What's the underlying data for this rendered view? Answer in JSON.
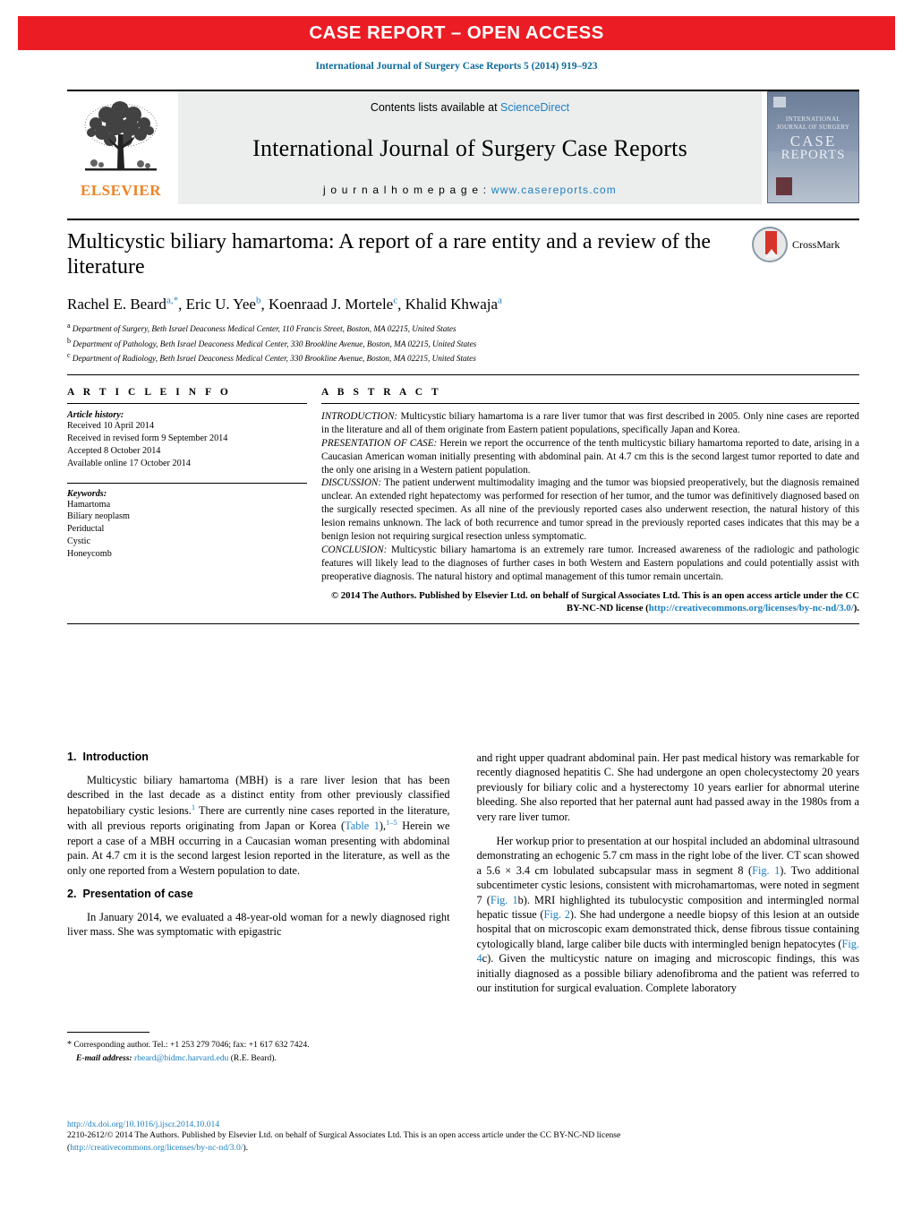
{
  "banner": {
    "text": "CASE REPORT – OPEN ACCESS",
    "color": "#ec1c24"
  },
  "journal_ref": "International Journal of Surgery Case Reports 5 (2014) 919–923",
  "masthead": {
    "publisher_name": "ELSEVIER",
    "publisher_logo_icon": "elsevier-tree-icon",
    "contents_prefix": "Contents lists available at ",
    "contents_link": "ScienceDirect",
    "journal_title": "International Journal of Surgery Case Reports",
    "homepage_prefix": "j o u r n a l   h o m e p a g e :  ",
    "homepage_url": "www.casereports.com",
    "cover": {
      "line1": "INTERNATIONAL",
      "line2": "JOURNAL OF SURGERY",
      "line3": "CASE",
      "line4": "REPORTS"
    }
  },
  "article": {
    "title": "Multicystic biliary hamartoma: A report of a rare entity and a review of the literature",
    "crossmark_label": "CrossMark",
    "authors": [
      {
        "name": "Rachel E. Beard",
        "marks": "a,*"
      },
      {
        "name": "Eric U. Yee",
        "marks": "b"
      },
      {
        "name": "Koenraad J. Mortele",
        "marks": "c"
      },
      {
        "name": "Khalid Khwaja",
        "marks": "a"
      }
    ],
    "affiliations": [
      {
        "mark": "a",
        "text": "Department of Surgery, Beth Israel Deaconess Medical Center, 110 Francis Street, Boston, MA 02215, United States"
      },
      {
        "mark": "b",
        "text": "Department of Pathology, Beth Israel Deaconess Medical Center, 330 Brookline Avenue, Boston, MA 02215, United States"
      },
      {
        "mark": "c",
        "text": "Department of Radiology, Beth Israel Deaconess Medical Center, 330 Brookline Avenue, Boston, MA 02215, United States"
      }
    ]
  },
  "article_info": {
    "heading": "A R T I C L E   I N F O",
    "history_label": "Article history:",
    "history": [
      "Received 10 April 2014",
      "Received in revised form 9 September 2014",
      "Accepted 8 October 2014",
      "Available online 17 October 2014"
    ],
    "keywords_label": "Keywords:",
    "keywords": [
      "Hamartoma",
      "Biliary neoplasm",
      "Periductal",
      "Cystic",
      "Honeycomb"
    ]
  },
  "abstract": {
    "heading": "A B S T R A C T",
    "sections": [
      {
        "label": "INTRODUCTION:",
        "text": " Multicystic biliary hamartoma is a rare liver tumor that was first described in 2005. Only nine cases are reported in the literature and all of them originate from Eastern patient populations, specifically Japan and Korea."
      },
      {
        "label": "PRESENTATION OF CASE:",
        "text": " Herein we report the occurrence of the tenth multicystic biliary hamartoma reported to date, arising in a Caucasian American woman initially presenting with abdominal pain. At 4.7 cm this is the second largest tumor reported to date and the only one arising in a Western patient population."
      },
      {
        "label": "DISCUSSION:",
        "text": " The patient underwent multimodality imaging and the tumor was biopsied preoperatively, but the diagnosis remained unclear. An extended right hepatectomy was performed for resection of her tumor, and the tumor was definitively diagnosed based on the surgically resected specimen. As all nine of the previously reported cases also underwent resection, the natural history of this lesion remains unknown. The lack of both recurrence and tumor spread in the previously reported cases indicates that this may be a benign lesion not requiring surgical resection unless symptomatic."
      },
      {
        "label": "CONCLUSION:",
        "text": " Multicystic biliary hamartoma is an extremely rare tumor. Increased awareness of the radiologic and pathologic features will likely lead to the diagnoses of further cases in both Western and Eastern populations and could potentially assist with preoperative diagnosis. The natural history and optimal management of this tumor remain uncertain."
      }
    ],
    "copyright_text": "© 2014 The Authors. Published by Elsevier Ltd. on behalf of Surgical Associates Ltd. This is an open access article under the CC BY-NC-ND license (",
    "copyright_link": "http://creativecommons.org/licenses/by-nc-nd/3.0/",
    "copyright_tail": ")."
  },
  "body": {
    "left": {
      "section1_num": "1.",
      "section1_title": "Introduction",
      "para1_a": "Multicystic biliary hamartoma (MBH) is a rare liver lesion that has been described in the last decade as a distinct entity from other previously classified hepatobiliary cystic lesions.",
      "ref1": "1",
      "para1_b": " There are currently nine cases reported in the literature, with all previous reports originating from Japan or Korea (",
      "table_link": "Table 1",
      "para1_c": "),",
      "ref2": "1–5",
      "para1_d": " Herein we report a case of a MBH occurring in a Caucasian woman presenting with abdominal pain. At 4.7 cm it is the second largest lesion reported in the literature, as well as the only one reported from a Western population to date.",
      "section2_num": "2.",
      "section2_title": "Presentation of case",
      "para2": "In January 2014, we evaluated a 48-year-old woman for a newly diagnosed right liver mass. She was symptomatic with epigastric"
    },
    "right": {
      "para_a": "and right upper quadrant abdominal pain. Her past medical history was remarkable for recently diagnosed hepatitis C. She had undergone an open cholecystectomy 20 years previously for biliary colic and a hysterectomy 10 years earlier for abnormal uterine bleeding. She also reported that her paternal aunt had passed away in the 1980s from a very rare liver tumor.",
      "para_b1": "Her workup prior to presentation at our hospital included an abdominal ultrasound demonstrating an echogenic 5.7 cm mass in the right lobe of the liver. CT scan showed a 5.6 × 3.4 cm lobulated subcapsular mass in segment 8 (",
      "fig1": "Fig. 1",
      "para_b2": "). Two additional subcentimeter cystic lesions, consistent with microhamartomas, were noted in segment 7 (",
      "fig1b": "Fig. 1",
      "para_b3": "b). MRI highlighted its tubulocystic composition and intermingled normal hepatic tissue (",
      "fig2": "Fig. 2",
      "para_b4": "). She had undergone a needle biopsy of this lesion at an outside hospital that on microscopic exam demonstrated thick, dense fibrous tissue containing cytologically bland, large caliber bile ducts with intermingled benign hepatocytes (",
      "fig4c": "Fig. 4",
      "para_b5": "c). Given the multicystic nature on imaging and microscopic findings, this was initially diagnosed as a possible biliary adenofibroma and the patient was referred to our institution for surgical evaluation. Complete laboratory"
    }
  },
  "footnote": {
    "star": "*",
    "corr_text": " Corresponding author. Tel.: +1 253 279 7046; fax: +1 617 632 7424.",
    "email_label": "E-mail address:",
    "email": "rbeard@bidmc.harvard.edu",
    "email_author": " (R.E. Beard)."
  },
  "bottom": {
    "doi": "http://dx.doi.org/10.1016/j.ijscr.2014.10.014",
    "line2": "2210-2612/© 2014 The Authors. Published by Elsevier Ltd. on behalf of Surgical Associates Ltd. This is an open access article under the CC BY-NC-ND license",
    "line3_open": "(",
    "line3_link": "http://creativecommons.org/licenses/by-nc-nd/3.0/",
    "line3_close": ")."
  },
  "colors": {
    "banner_red": "#ec1c24",
    "link_blue": "#1a7fc1",
    "elsevier_orange": "#f08222",
    "masthead_grey": "#eceded"
  }
}
